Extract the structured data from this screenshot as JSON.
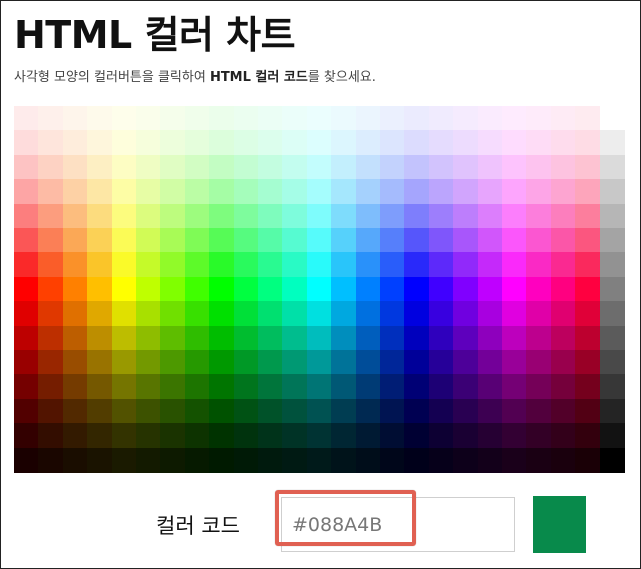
{
  "page": {
    "title": "HTML 컬러 차트",
    "subtitle_before": "사각형 모양의 컬러버튼을 클릭하여 ",
    "subtitle_bold": "HTML 컬러 코드",
    "subtitle_after": "를 찾으세요."
  },
  "picker": {
    "label": "컬러 코드",
    "value": "#088A4B",
    "swatch_color": "#088A4B",
    "highlight_color": "#E06052"
  },
  "palette": {
    "columns": 24,
    "rows": 15,
    "hue_columns": 24,
    "grayscale_column": true
  }
}
